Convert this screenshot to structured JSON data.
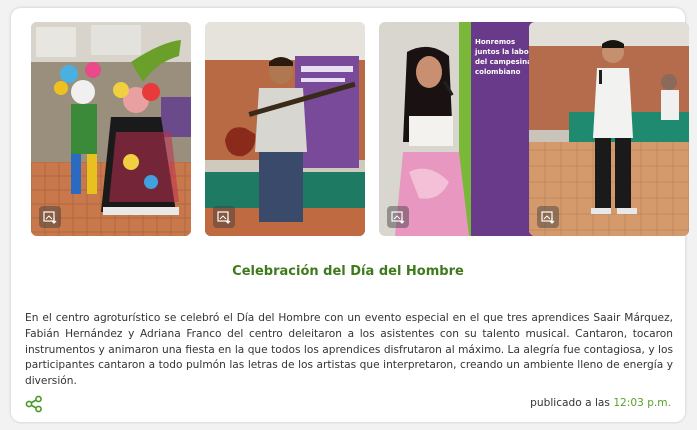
{
  "post": {
    "title": "Celebración del Día del Hombre",
    "description": "En el centro agroturístico se celebró el Día del Hombre con un evento especial en el que tres aprendices Saair Márquez, Fabián Hernández y Adriana Franco del centro deleitaron a los asistentes con su talento musical. Cantaron, tocaron instrumentos y animaron una fiesta en la que todos los aprendices disfrutaron al máximo. La alegría fue contagiosa, y los participantes cantaron a todo pulmón las letras de los artistas que interpretaron, creando un ambiente lleno de energía y diversión.",
    "published_prefix": "publicado a las",
    "published_time": "12:03 p.m."
  },
  "gallery": {
    "photos": [
      {
        "subject": "carnival-costume-performers",
        "download_icon": "download-image-icon"
      },
      {
        "subject": "bass-guitarist",
        "download_icon": "download-image-icon"
      },
      {
        "subject": "female-singer",
        "download_icon": "download-image-icon"
      },
      {
        "subject": "male-singer",
        "download_icon": "download-image-icon"
      }
    ],
    "banner_text": "Honremos juntos la labor del campesinado colombiano"
  },
  "icons": {
    "share": "share-icon",
    "download": "download-image-icon"
  },
  "colors": {
    "title": "#3e7a1c",
    "time": "#5aa02c",
    "share": "#4a9a2a",
    "text": "#333333"
  }
}
